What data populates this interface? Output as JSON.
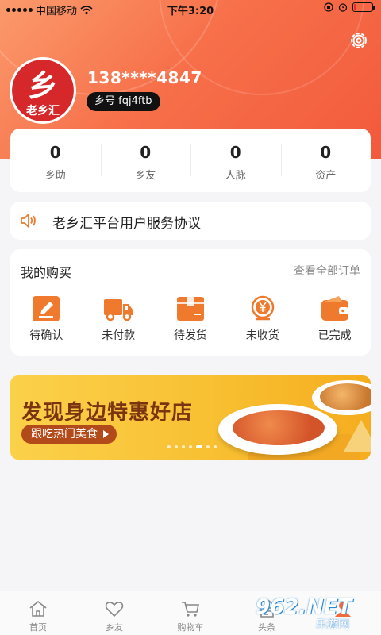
{
  "status_bar": {
    "carrier": "中国移动",
    "time": "下午3:20",
    "battery_level": 0.15
  },
  "header": {
    "settings_icon": "gear-icon"
  },
  "user": {
    "avatar_logo_text": "老乡汇",
    "phone": "138****4847",
    "xianghao": "乡号 fqj4ftb"
  },
  "stats": [
    {
      "value": "0",
      "label": "乡助"
    },
    {
      "value": "0",
      "label": "乡友"
    },
    {
      "value": "0",
      "label": "人脉"
    },
    {
      "value": "0",
      "label": "资产"
    }
  ],
  "agreement": {
    "icon": "speaker-icon",
    "text": "老乡汇平台用户服务协议"
  },
  "purchases": {
    "title": "我的购买",
    "view_all": "查看全部订单",
    "orders": [
      {
        "icon": "edit-icon",
        "label": "待确认"
      },
      {
        "icon": "truck-icon",
        "label": "未付款"
      },
      {
        "icon": "box-icon",
        "label": "待发货"
      },
      {
        "icon": "yen-coin-icon",
        "label": "未收货"
      },
      {
        "icon": "wallet-icon",
        "label": "已完成"
      }
    ]
  },
  "banner": {
    "headline": "发现身边特惠好店",
    "cta": "跟吃热门美食",
    "pages": 7,
    "active_page": 4
  },
  "tabbar": [
    {
      "icon": "home-icon",
      "label": "首页"
    },
    {
      "icon": "heart-icon",
      "label": "乡友"
    },
    {
      "icon": "cart-icon",
      "label": "购物车"
    },
    {
      "icon": "document-icon",
      "label": "头条"
    },
    {
      "icon": "profile-icon",
      "label": ""
    }
  ],
  "watermark": {
    "logo": "962.NET",
    "sub": "乐游网"
  },
  "colors": {
    "header_gradient_start": "#fb9a6c",
    "header_gradient_end": "#f25a3c",
    "accent_orange": "#ef7a2d",
    "brand_red": "#d6282a",
    "banner_yellow": "#f8c033"
  }
}
